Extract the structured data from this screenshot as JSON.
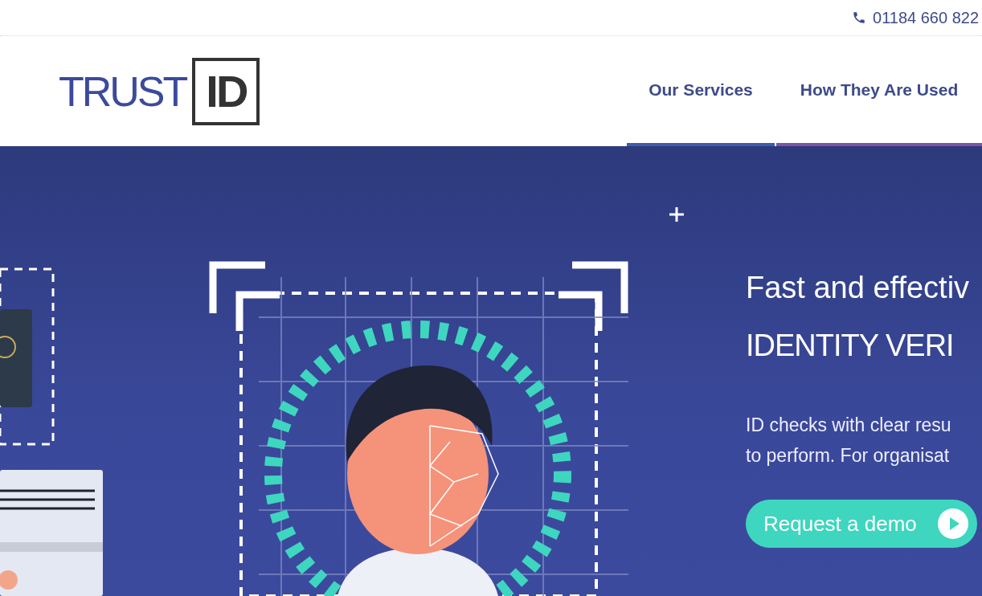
{
  "top_bar": {
    "phone": "01184 660 822"
  },
  "logo": {
    "word": "TRUST",
    "boxed": "ID"
  },
  "nav": [
    {
      "label": "Our Services",
      "color": "#3f5bab"
    },
    {
      "label": "How They Are Used",
      "color": "#7a56a6"
    }
  ],
  "hero": {
    "heading": "Fast and effectiv",
    "subheading": "IDENTITY VERI",
    "text_lines": [
      "ID checks with clear resu",
      "to perform. For organisat"
    ],
    "button": "Request a demo"
  }
}
